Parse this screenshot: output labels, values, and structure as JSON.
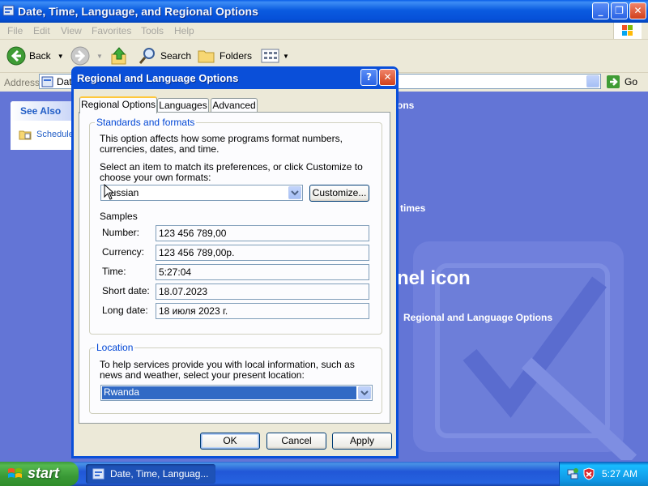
{
  "window": {
    "title": "Date, Time, Language, and Regional Options",
    "minimize": "_",
    "restore": "❐",
    "close": "✕"
  },
  "menu": [
    "File",
    "Edit",
    "View",
    "Favorites",
    "Tools",
    "Help"
  ],
  "toolbar": {
    "back_label": "Back",
    "search_label": "Search",
    "folders_label": "Folders"
  },
  "address": {
    "label": "Address",
    "value": "Dat",
    "go_label": "Go"
  },
  "sidepanel": {
    "see_also": "See Also",
    "items": [
      "Schedule"
    ]
  },
  "background": {
    "text_options": "ons",
    "text_times": "times",
    "text_icon": "nel icon",
    "text_link": "Regional and Language Options"
  },
  "dialog": {
    "title": "Regional and Language Options",
    "help": "?",
    "close": "✕",
    "tabs": [
      "Regional Options",
      "Languages",
      "Advanced"
    ],
    "standards": {
      "label": "Standards and formats",
      "desc": "This option affects how some programs format numbers, currencies, dates, and time.",
      "select_text": "Select an item to match its preferences, or click Customize to choose your own formats:",
      "selected": "Russian",
      "customize": "Customize...",
      "samples_label": "Samples",
      "samples": [
        {
          "label": "Number:",
          "value": "123 456 789,00"
        },
        {
          "label": "Currency:",
          "value": "123 456 789,00р."
        },
        {
          "label": "Time:",
          "value": "5:27:04"
        },
        {
          "label": "Short date:",
          "value": "18.07.2023"
        },
        {
          "label": "Long date:",
          "value": "18 июля 2023 г."
        }
      ]
    },
    "location": {
      "label": "Location",
      "desc": "To help services provide you with local information, such as news and weather, select your present location:",
      "selected": "Rwanda"
    },
    "buttons": {
      "ok": "OK",
      "cancel": "Cancel",
      "apply": "Apply"
    }
  },
  "taskbar": {
    "start": "start",
    "task_label": "Date, Time, Languag...",
    "clock": "5:27 AM"
  },
  "colors": {
    "title_blue": "#0a5ee8",
    "content_bg": "#6375d6",
    "dialog_face": "#ece9d8",
    "selection": "#316ac5",
    "start_green": "#3a9a37"
  }
}
